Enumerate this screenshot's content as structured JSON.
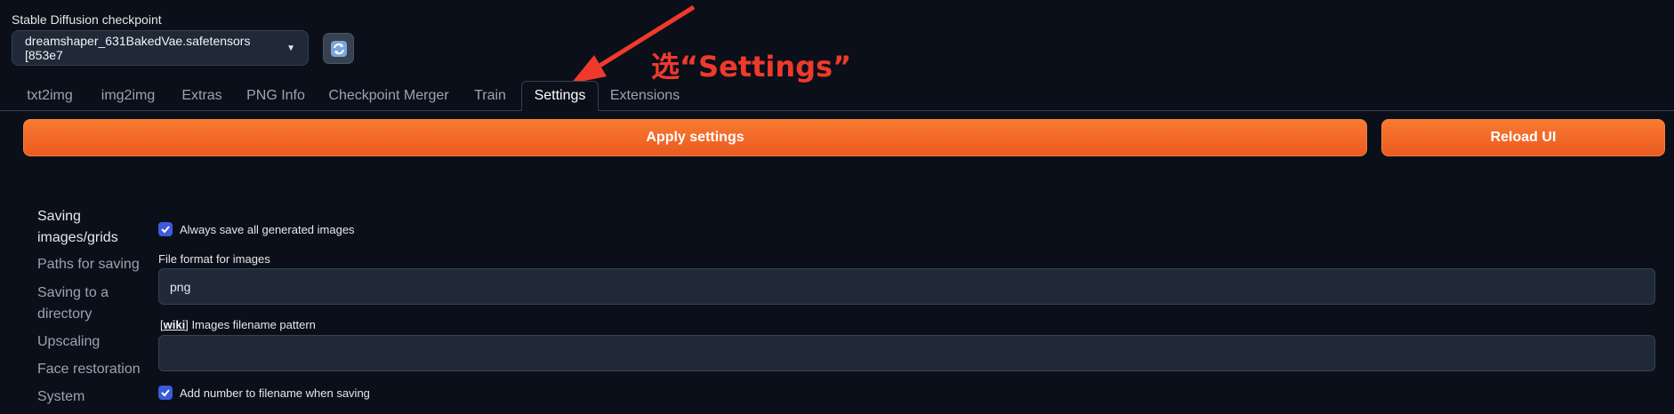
{
  "checkpoint": {
    "label": "Stable Diffusion checkpoint",
    "value": "dreamshaper_631BakedVae.safetensors [853e7"
  },
  "tabs": [
    "txt2img",
    "img2img",
    "Extras",
    "PNG Info",
    "Checkpoint Merger",
    "Train",
    "Settings",
    "Extensions"
  ],
  "active_tab": "Settings",
  "buttons": {
    "apply": "Apply settings",
    "reload": "Reload UI"
  },
  "sidebar": {
    "items": [
      {
        "label_line1": "Saving",
        "label_line2": "images/grids"
      },
      {
        "label_line1": "Paths for saving"
      },
      {
        "label_line1": "Saving to a",
        "label_line2": "directory"
      },
      {
        "label_line1": "Upscaling"
      },
      {
        "label_line1": "Face restoration"
      },
      {
        "label_line1": "System"
      }
    ]
  },
  "settings": {
    "always_save_label": "Always save all generated images",
    "always_save_checked": true,
    "file_format_label": "File format for images",
    "file_format_value": "png",
    "wiki_link": "wiki",
    "filename_pattern_label": "Images filename pattern",
    "filename_pattern_value": "",
    "add_number_label": "Add number to filename when saving",
    "add_number_checked": true
  },
  "annotation": {
    "text": "选“Settings”",
    "color": "#ef3a2b"
  },
  "colors": {
    "accent_orange": "#f97a32",
    "checkbox_blue": "#3b5bdb",
    "background": "#0b0f19"
  }
}
